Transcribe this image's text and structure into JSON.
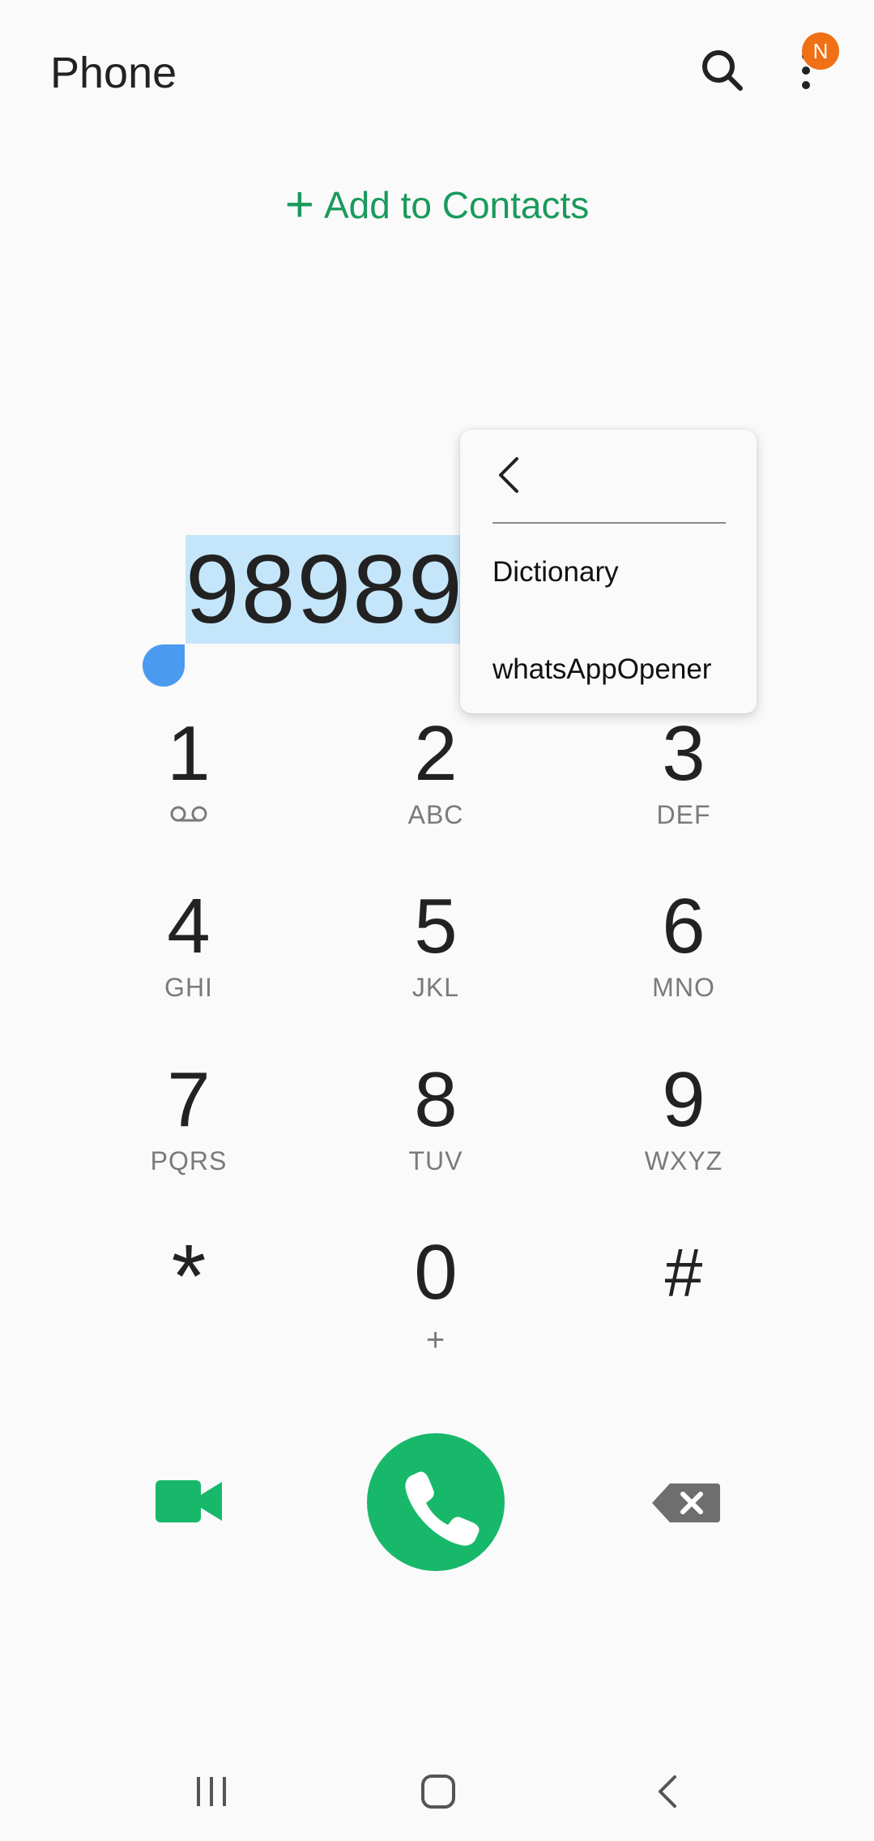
{
  "header": {
    "title": "Phone",
    "search_icon": "search-icon",
    "more_icon": "more-vertical-icon",
    "notification_badge": "N",
    "badge_color": "#f07015"
  },
  "add_contacts": {
    "label": "Add to Contacts",
    "plus": "+",
    "color": "#1a9a5c"
  },
  "dial_number": {
    "value": "989898",
    "selection_color": "#c5e6fa"
  },
  "context_menu": {
    "back_icon": "chevron-left-icon",
    "items": [
      "Dictionary",
      "whatsAppOpener"
    ]
  },
  "keypad": [
    {
      "digit": "1",
      "sub": "",
      "sub_icon": "voicemail-icon"
    },
    {
      "digit": "2",
      "sub": "ABC"
    },
    {
      "digit": "3",
      "sub": "DEF"
    },
    {
      "digit": "4",
      "sub": "GHI"
    },
    {
      "digit": "5",
      "sub": "JKL"
    },
    {
      "digit": "6",
      "sub": "MNO"
    },
    {
      "digit": "7",
      "sub": "PQRS"
    },
    {
      "digit": "8",
      "sub": "TUV"
    },
    {
      "digit": "9",
      "sub": "WXYZ"
    },
    {
      "digit": "*",
      "sub": ""
    },
    {
      "digit": "0",
      "sub": "+"
    },
    {
      "digit": "#",
      "sub": ""
    }
  ],
  "actions": {
    "video_icon": "video-call-icon",
    "call_icon": "phone-call-icon",
    "backspace_icon": "backspace-icon",
    "accent_color": "#17b86a"
  },
  "nav": {
    "recents_icon": "recents-icon",
    "home_icon": "home-icon",
    "back_icon": "back-icon"
  }
}
